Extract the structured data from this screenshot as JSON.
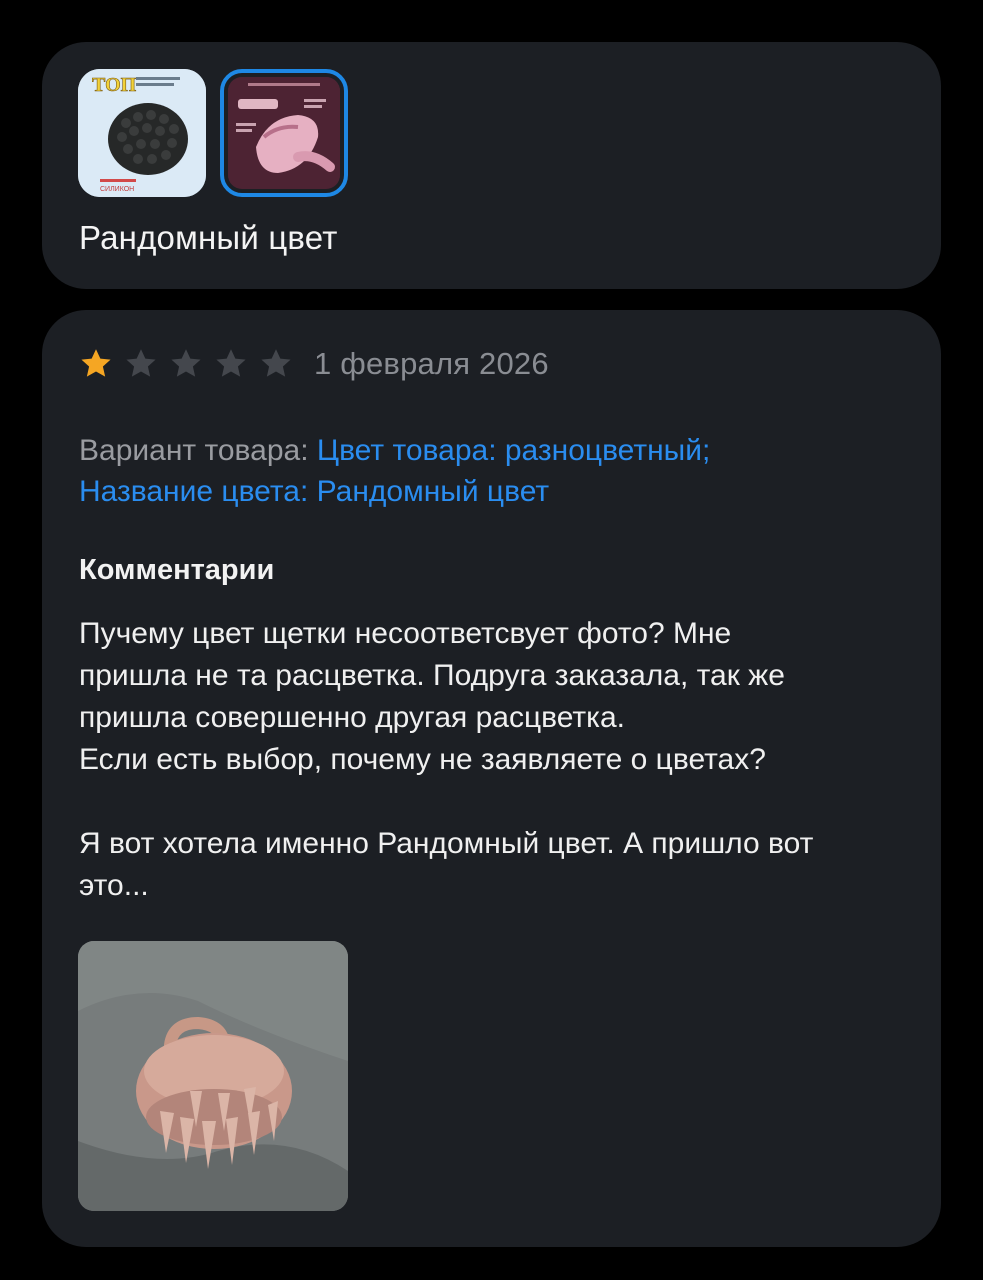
{
  "colors": {
    "background": "#000000",
    "card": "#1c1f24",
    "star_active": "#f5a623",
    "star_inactive": "#44474d",
    "link_blue": "#2a8df0",
    "muted_text": "#9a9ca1",
    "selected_border": "#1e88e5"
  },
  "variant_card": {
    "thumbnails": [
      {
        "icon": "product-photo-black-brush",
        "selected": false,
        "texts": [
          "ТОП",
          "СИЛИКОН"
        ]
      },
      {
        "icon": "product-photo-pink-brush",
        "selected": true
      }
    ],
    "selected_variant": "Рандомный цвет"
  },
  "review": {
    "rating": 1,
    "rating_max": 5,
    "date": "1 февраля 2026",
    "variant_label": "Вариант товара: ",
    "variant_value_1": "Цвет товара: разноцветный;",
    "variant_value_2": "Название цвета: Рандомный цвет",
    "comments_heading": "Комментарии",
    "comment": "Пучему цвет щетки несоответсвует фото? Мне\nпришла не та расцветка. Подруга заказала,  так же\nпришла совершенно другая расцветка.\nЕсли есть выбор, почему не заявляете о цветах?\n\nЯ вот хотела именно Рандомный цвет. А пришло вот\nэто...",
    "photo_icon": "review-photo-pink-brush"
  }
}
